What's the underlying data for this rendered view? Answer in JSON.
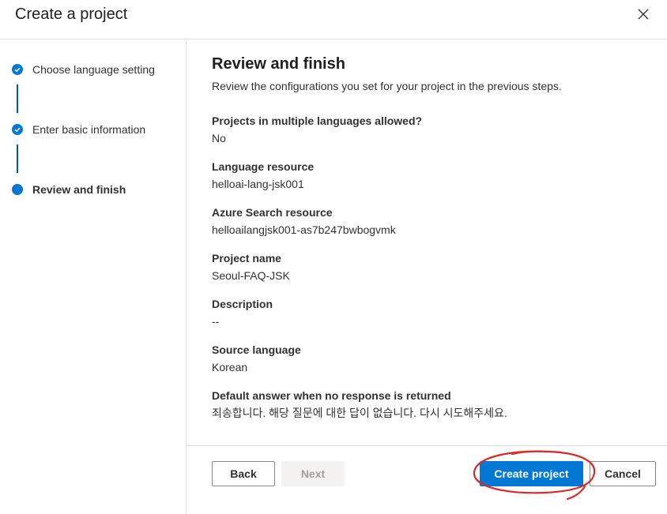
{
  "dialog": {
    "title": "Create a project",
    "close_icon": "close-icon"
  },
  "steps": [
    {
      "label": "Choose language setting",
      "status": "complete",
      "icon": "checkmark-icon"
    },
    {
      "label": "Enter basic information",
      "status": "complete",
      "icon": "checkmark-icon"
    },
    {
      "label": "Review and finish",
      "status": "current",
      "icon": "current-step-dot-icon"
    }
  ],
  "review": {
    "title": "Review and finish",
    "description": "Review the configurations you set for your project in the previous steps.",
    "fields": [
      {
        "label": "Projects in multiple languages allowed?",
        "value": "No"
      },
      {
        "label": "Language resource",
        "value": "helloai-lang-jsk001"
      },
      {
        "label": "Azure Search resource",
        "value": "helloailangjsk001-as7b247bwbogvmk"
      },
      {
        "label": "Project name",
        "value": "Seoul-FAQ-JSK"
      },
      {
        "label": "Description",
        "value": "--"
      },
      {
        "label": "Source language",
        "value": "Korean"
      },
      {
        "label": "Default answer when no response is returned",
        "value": "죄송합니다. 해당 질문에 대한 답이 없습니다. 다시 시도해주세요."
      }
    ]
  },
  "footer": {
    "back_label": "Back",
    "next_label": "Next",
    "create_label": "Create project",
    "cancel_label": "Cancel"
  },
  "colors": {
    "accent": "#0078d4",
    "annotation": "#d92b2b"
  }
}
